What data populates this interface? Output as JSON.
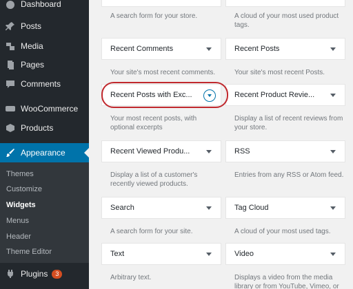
{
  "sidebar": {
    "dashboard": "Dashboard",
    "posts": "Posts",
    "media": "Media",
    "pages": "Pages",
    "comments": "Comments",
    "woocommerce": "WooCommerce",
    "products": "Products",
    "appearance": "Appearance",
    "submenu": [
      "Themes",
      "Customize",
      "Widgets",
      "Menus",
      "Header",
      "Theme Editor"
    ],
    "plugins": "Plugins",
    "plugins_badge": "3"
  },
  "widgets": {
    "top_left_desc": "A search form for your store.",
    "top_right_desc": "A cloud of your most used product tags.",
    "recent_comments": {
      "title": "Recent Comments",
      "desc": "Your site's most recent comments."
    },
    "recent_posts": {
      "title": "Recent Posts",
      "desc": "Your site's most recent Posts."
    },
    "recent_posts_excerpts": {
      "title": "Recent Posts with Exc...",
      "desc": "Your most recent posts, with optional excerpts"
    },
    "recent_product_reviews": {
      "title": "Recent Product Revie...",
      "desc": "Display a list of recent reviews from your store."
    },
    "recent_viewed_products": {
      "title": "Recent Viewed Produ...",
      "desc": "Display a list of a customer's recently viewed products."
    },
    "rss": {
      "title": "RSS",
      "desc": "Entries from any RSS or Atom feed."
    },
    "search": {
      "title": "Search",
      "desc": "A search form for your site."
    },
    "tag_cloud": {
      "title": "Tag Cloud",
      "desc": "A cloud of your most used tags."
    },
    "text": {
      "title": "Text",
      "desc": "Arbitrary text."
    },
    "video": {
      "title": "Video",
      "desc": "Displays a video from the media library or from YouTube, Vimeo, or"
    }
  },
  "colors": {
    "accent": "#0073aa",
    "highlight": "#c0282d",
    "sidebar": "#23282d"
  }
}
